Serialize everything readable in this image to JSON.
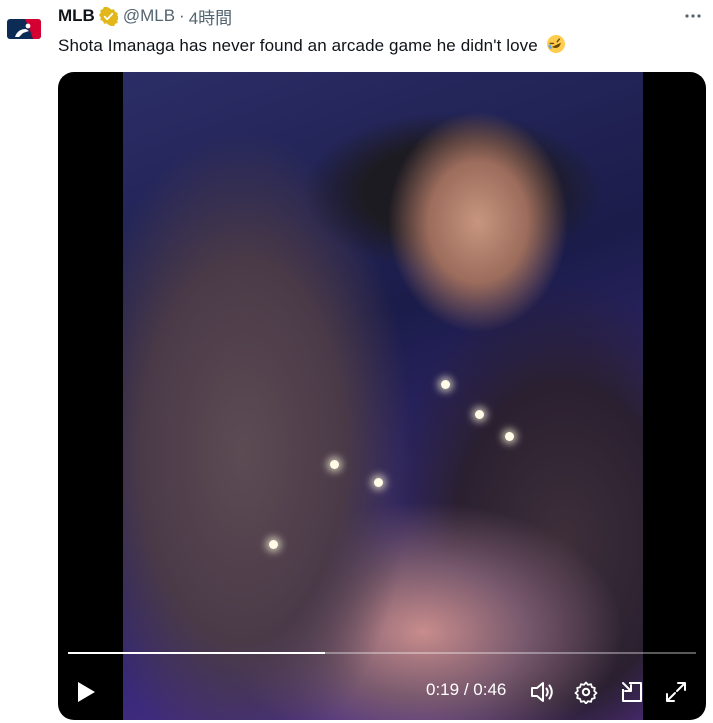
{
  "tweet": {
    "display_name": "MLB",
    "handle": "@MLB",
    "separator": "·",
    "timestamp": "4時間",
    "text": "Shota Imanaga has never found an arcade game he didn't love",
    "emoji": "rolling-on-the-floor-laughing"
  },
  "video": {
    "current_time": "0:19",
    "time_separator": " / ",
    "duration": "0:46",
    "progress_fraction": 0.41
  },
  "icons": {
    "avatar": "mlb-logo-icon",
    "verified": "verified-badge-icon",
    "more": "more-icon",
    "play": "play-icon",
    "volume": "volume-icon",
    "settings": "settings-icon",
    "pip": "picture-in-picture-icon",
    "fullscreen": "fullscreen-icon"
  },
  "colors": {
    "text_primary": "#0f1419",
    "text_secondary": "#536471",
    "verified_gold": "#e2b719",
    "mlb_blue": "#0c2c56",
    "mlb_red": "#d50032"
  }
}
